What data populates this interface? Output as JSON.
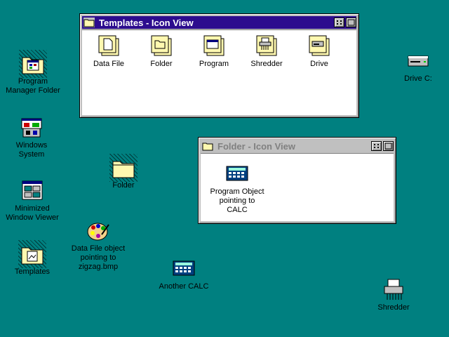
{
  "desktop": {
    "icons": [
      {
        "label": "Program\nManager Folder",
        "icon": "program-manager-folder-icon"
      },
      {
        "label": "Windows\nSystem",
        "icon": "windows-system-icon"
      },
      {
        "label": "Minimized\nWindow Viewer",
        "icon": "minimized-window-viewer-icon"
      },
      {
        "label": "Templates",
        "icon": "templates-folder-icon"
      },
      {
        "label": "Folder",
        "icon": "folder-icon"
      },
      {
        "label": "Data File object\npointing to\nzigzag.bmp",
        "icon": "paint-palette-icon"
      },
      {
        "label": "Another CALC",
        "icon": "calculator-icon"
      },
      {
        "label": "Drive C:",
        "icon": "drive-icon"
      },
      {
        "label": "Shredder",
        "icon": "shredder-icon"
      }
    ]
  },
  "templates_window": {
    "title": "Templates - Icon View",
    "items": [
      {
        "label": "Data File",
        "icon": "data-file-template-icon"
      },
      {
        "label": "Folder",
        "icon": "folder-template-icon"
      },
      {
        "label": "Program",
        "icon": "program-template-icon"
      },
      {
        "label": "Shredder",
        "icon": "shredder-template-icon"
      },
      {
        "label": "Drive",
        "icon": "drive-template-icon"
      }
    ]
  },
  "folder_window": {
    "title": "Folder - Icon View",
    "items": [
      {
        "label": "Program Object\npointing to\nCALC",
        "icon": "calculator-icon"
      }
    ]
  },
  "colors": {
    "desktop": "#008080",
    "active_title": "#2c0c8e",
    "window_face": "#c0c0c0"
  }
}
